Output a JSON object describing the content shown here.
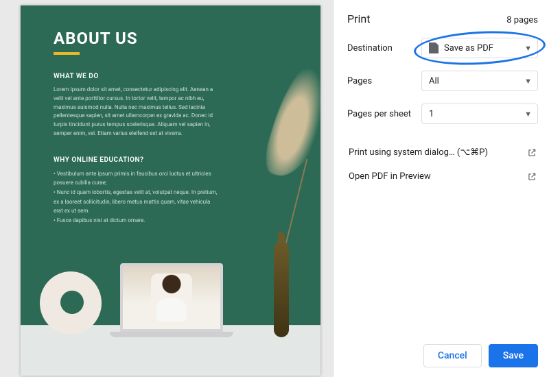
{
  "preview": {
    "heading": "ABOUT US",
    "section1_title": "WHAT WE DO",
    "section1_body": "Lorem ipsum dolor sit amet, consectetur adipiscing elit. Aenean a velit vel ante porttitor cursus. In tortor velit, tempor ac nibh eu, maximus euismod nulla. Nulla nec maximus tellus. Sed lacinia pellentesque sapien, sit amet ullamcorper ex gravida ac. Donec id turpis tincidunt purus tempus scelerisque. Aliquam vel sapien in, semper enim, vel. Etiam varius eleifend est at viverra.",
    "section2_title": "WHY ONLINE EDUCATION?",
    "section2_bullets": [
      "Vestibulum ante ipsum primis in faucibus orci luctus et ultricies posuere cubilia curae;",
      "Nunc id quam lobortis, egestas velit at, volutpat neque. In pretium, ex a laoreet sollicitudin, libero metus mattis quam, vitae vehicula erat ex ut sem.",
      "Fusce dapibus nisi at dictum ornare."
    ]
  },
  "panel": {
    "title": "Print",
    "page_count": "8 pages",
    "rows": {
      "destination_label": "Destination",
      "destination_value": "Save as PDF",
      "pages_label": "Pages",
      "pages_value": "All",
      "pps_label": "Pages per sheet",
      "pps_value": "1"
    },
    "links": {
      "system_dialog": "Print using system dialog… (⌥⌘P)",
      "open_preview": "Open PDF in Preview"
    },
    "buttons": {
      "cancel": "Cancel",
      "save": "Save"
    }
  }
}
